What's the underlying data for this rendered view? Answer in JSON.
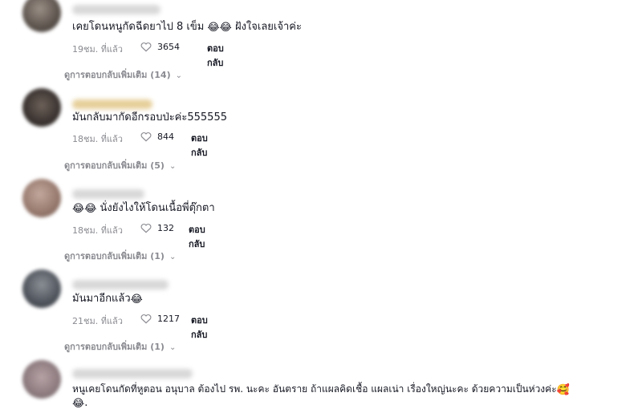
{
  "comments": [
    {
      "text": "เคยโดนหนูกัดฉีดยาไป 8 เข็ม",
      "text_after": "ฝังใจเลยเจ้าค่ะ",
      "emojis": [
        "😂",
        "😂"
      ],
      "time": "19ชม. ที่แล้ว",
      "likes": "3654",
      "reply": "ตอบกลับ",
      "more": "ดูการตอบกลับเพิ่มเติม (14)"
    },
    {
      "text": "มันกลับมากัดอีกรอบป่ะค่ะ555555",
      "time": "18ชม. ที่แล้ว",
      "likes": "844",
      "reply": "ตอบกลับ",
      "more": "ดูการตอบกลับเพิ่มเติม (5)"
    },
    {
      "emojis": [
        "😂",
        "😂"
      ],
      "text": "นั่งยังไงให้โดนเนื้อพี่ตุ๊กตา",
      "time": "18ชม. ที่แล้ว",
      "likes": "132",
      "reply": "ตอบกลับ",
      "more": "ดูการตอบกลับเพิ่มเติม (1)"
    },
    {
      "text": "มันมาอีกแล้ว",
      "emojis": [
        "😂"
      ],
      "time": "21ชม. ที่แล้ว",
      "likes": "1217",
      "reply": "ตอบกลับ",
      "more": "ดูการตอบกลับเพิ่มเติม (1)"
    },
    {
      "text": "หนูเคยโดนกัดที่หูตอน อนุบาล ต้องไป รพ. นะคะ อันตราย ถ้าแผลคิดเชื้อ แผลเน่า เรื่องใหญ่นะคะ ด้วยความเป็นห่วงค่ะ",
      "emojis": [
        "🥰",
        "😂"
      ],
      "trail": "."
    }
  ],
  "icons": {
    "like": "heart-outline-icon",
    "chevron": "chevron-down-icon"
  },
  "colors": {
    "meta": "#8a8b91",
    "text": "#161823"
  }
}
